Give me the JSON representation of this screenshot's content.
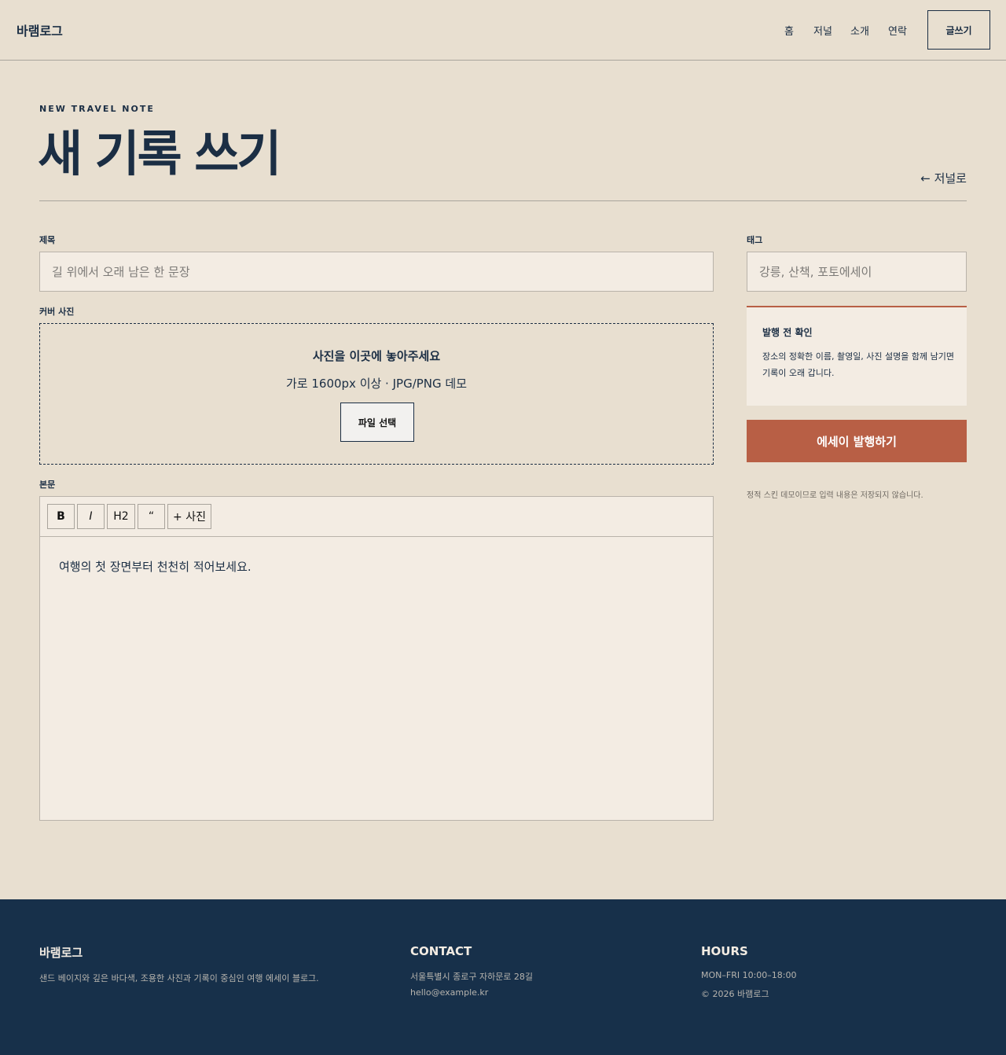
{
  "header": {
    "brand": "바램로그",
    "nav": [
      "홈",
      "저널",
      "소개",
      "연락"
    ],
    "write_label": "글쓰기"
  },
  "hero": {
    "eyebrow": "NEW TRAVEL NOTE",
    "title": "새 기록 쓰기",
    "back_link": "← 저널로"
  },
  "form": {
    "title_label": "제목",
    "title_placeholder": "길 위에서 오래 남은 한 문장",
    "tags_label": "태그",
    "tags_placeholder": "강릉, 산책, 포토에세이",
    "cover_label": "커버 사진",
    "cover_title": "사진을 이곳에 놓아주세요",
    "cover_hint": "가로 1600px 이상 · JPG/PNG 데모",
    "file_button": "파일 선택",
    "body_label": "본문",
    "toolbar": [
      "B",
      "I",
      "H2",
      "“",
      "+ 사진"
    ],
    "body_placeholder": "여행의 첫 장면부터 천천히 적어보세요."
  },
  "sidebar": {
    "check_title": "발행 전 확인",
    "check_text": "장소의 정확한 이름, 촬영일, 사진 설명을 함께 남기면 기록이 오래 갑니다.",
    "publish_button": "에세이 발행하기",
    "demo_note": "정적 스킨 데모이므로 입력 내용은 저장되지 않습니다."
  },
  "footer": {
    "brand": "바램로그",
    "description": "샌드 베이지와 깊은 바다색, 조용한 사진과 기록이 중심인 여행 에세이 블로그.",
    "contact_heading": "CONTACT",
    "address": "서울특별시 종로구 자하문로 28길",
    "email": "hello@example.kr",
    "hours_heading": "HOURS",
    "hours": "MON–FRI 10:00–18:00",
    "copyright": "© 2026 바램로그"
  },
  "colors": {
    "background": "#e8dfd0",
    "navy": "#1b2e44",
    "accent": "#b85f45",
    "panel": "#f3ece3",
    "footer": "#17304a"
  }
}
